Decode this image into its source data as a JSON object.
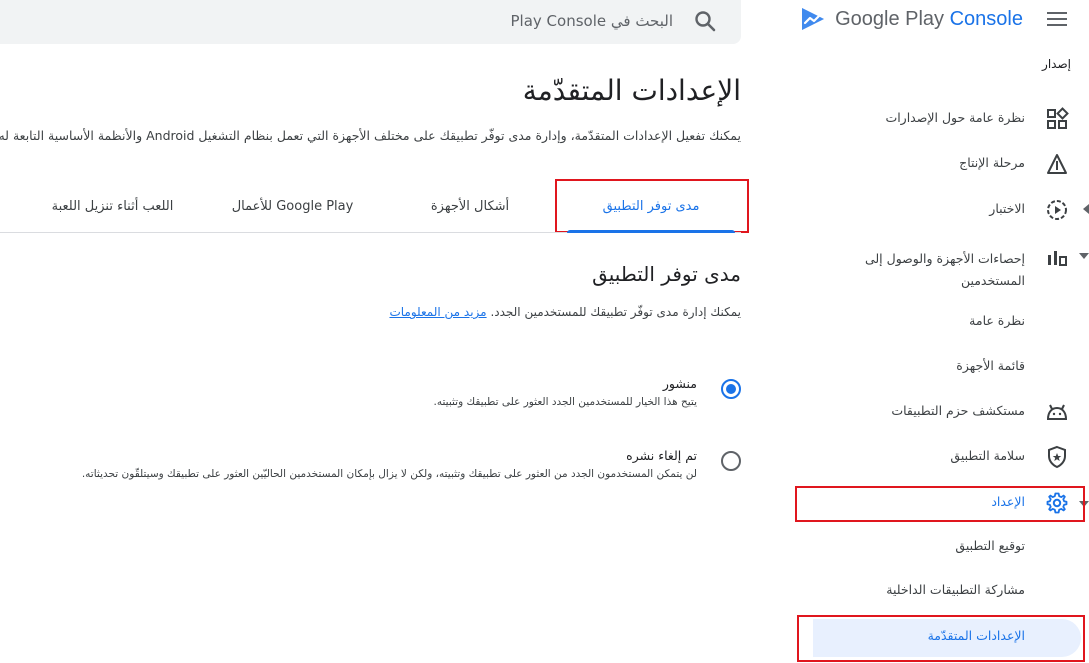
{
  "app": {
    "logo_google": "Google Play ",
    "logo_console": "Console"
  },
  "search": {
    "placeholder": "البحث في Play Console"
  },
  "sidebar": {
    "section_label": "إصدار",
    "items": [
      {
        "label": "نظرة عامة حول الإصدارات",
        "icon": "dashboard-icon"
      },
      {
        "label": "مرحلة الإنتاج",
        "icon": "production-icon"
      },
      {
        "label": "الاختبار",
        "icon": "play-circle-icon"
      },
      {
        "label": "إحصاءات الأجهزة والوصول إلى",
        "label2": "المستخدمين",
        "icon": "bar-chart-icon"
      },
      {
        "label": "نظرة عامة"
      },
      {
        "label": "قائمة الأجهزة"
      },
      {
        "label": "مستكشف حزم التطبيقات",
        "icon": "android-icon"
      },
      {
        "label": "سلامة التطبيق",
        "icon": "shield-star-icon"
      },
      {
        "label": "الإعداد",
        "icon": "gear-icon"
      },
      {
        "label": "توقيع التطبيق"
      },
      {
        "label": "مشاركة التطبيقات الداخلية"
      },
      {
        "label": "الإعدادات المتقدّمة"
      }
    ]
  },
  "main": {
    "title": "الإعدادات المتقدّمة",
    "description": "يمكنك تفعيل الإعدادات المتقدّمة، وإدارة مدى توفّر تطبيقك على مختلف الأجهزة التي تعمل بنظام التشغيل Android والأنظمة الأساسية التابعة له",
    "tabs": [
      {
        "label": "مدى توفر التطبيق",
        "active": true
      },
      {
        "label": "أشكال الأجهزة"
      },
      {
        "label": "Google Play للأعمال"
      },
      {
        "label": "اللعب أثناء تنزيل اللعبة"
      }
    ],
    "section": {
      "title": "مدى توفر التطبيق",
      "description": "يمكنك إدارة مدى توفّر تطبيقك للمستخدمين الجدد.",
      "link": "مزيد من المعلومات"
    },
    "options": [
      {
        "title": "منشور",
        "description": "يتيح هذا الخيار للمستخدمين الجدد العثور على تطبيقك وتثبيته.",
        "selected": true
      },
      {
        "title": "تم إلغاء نشره",
        "description": "لن يتمكن المستخدمون الجدد من العثور على تطبيقك وتثبيته، ولكن لا يزال بإمكان المستخدمين الحاليّين العثور على تطبيقك وسيتلقّون تحديثاته.",
        "selected": false
      }
    ]
  },
  "colors": {
    "accent": "#1a73e8",
    "highlight_box": "#e0161e",
    "selected_bg": "#e8f0fe"
  }
}
